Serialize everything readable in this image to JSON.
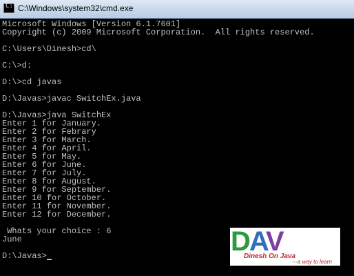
{
  "window": {
    "title": "C:\\Windows\\system32\\cmd.exe"
  },
  "console": {
    "lines": [
      "Microsoft Windows [Version 6.1.7601]",
      "Copyright (c) 2009 Microsoft Corporation.  All rights reserved.",
      "",
      "C:\\Users\\Dinesh>cd\\",
      "",
      "C:\\>d:",
      "",
      "D:\\>cd javas",
      "",
      "D:\\Javas>javac SwitchEx.java",
      "",
      "D:\\Javas>java SwitchEx",
      "Enter 1 for January.",
      "Enter 2 for Febrary",
      "Enter 3 for March.",
      "Enter 4 for April.",
      "Enter 5 for May.",
      "Enter 6 for June.",
      "Enter 7 for July.",
      "Enter 8 for August.",
      "Enter 9 for September.",
      "Enter 10 for October.",
      "Enter 11 for November.",
      "Enter 12 for December.",
      "",
      " Whats your choice : 6",
      "June",
      "",
      "D:\\Javas>"
    ]
  },
  "watermark": {
    "logo_text": "DAV",
    "name": "Dinesh On Java",
    "tagline": "---a way to learn",
    "colors": {
      "d": "#2e9a3e",
      "a": "#2f6fbf",
      "v": "#7a3fa0",
      "accent": "#c0272d"
    }
  },
  "colors": {
    "console_bg": "#000000",
    "console_text": "#c0c0c0"
  }
}
